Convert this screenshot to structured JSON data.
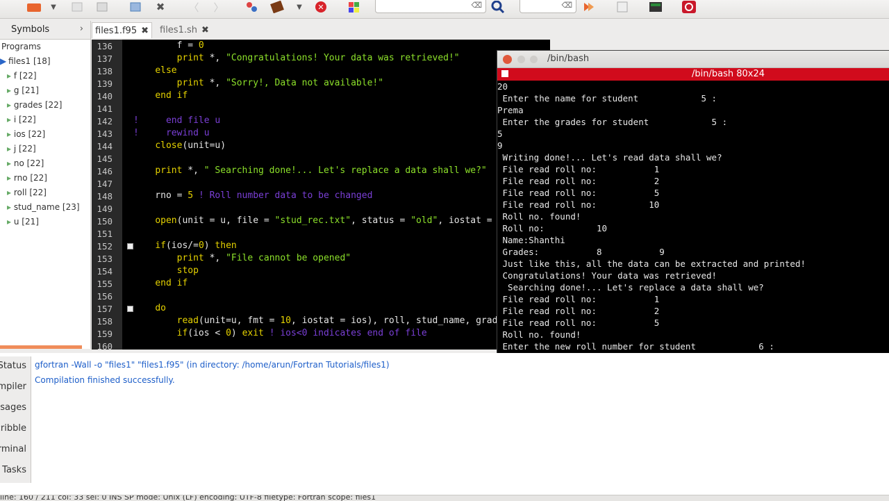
{
  "toolbar": {
    "icons": [
      "new-file-icon",
      "dropdown-arrow-icon",
      "open-icon",
      "save-icon",
      "revert-icon",
      "close-icon",
      "back-icon",
      "forward-icon",
      "compile-icon",
      "build-icon",
      "dropdown-arrow-icon",
      "stop-icon",
      "color-chooser-icon",
      "search-icon",
      "jump-icon",
      "preferences-icon",
      "terminal-icon",
      "quit-icon"
    ],
    "search_value": "",
    "goto_value": ""
  },
  "sidebar": {
    "tab_label": "Symbols",
    "tree": [
      {
        "label": "Programs"
      },
      {
        "label": "files1 [18]"
      },
      {
        "label": "f [22]"
      },
      {
        "label": "g [21]"
      },
      {
        "label": "grades [22]"
      },
      {
        "label": "i [22]"
      },
      {
        "label": "ios [22]"
      },
      {
        "label": "j [22]"
      },
      {
        "label": "no [22]"
      },
      {
        "label": "rno [22]"
      },
      {
        "label": "roll [22]"
      },
      {
        "label": "stud_name [23]"
      },
      {
        "label": "u [21]"
      }
    ]
  },
  "editor": {
    "tabs": [
      {
        "label": "files1.f95",
        "close": "✖"
      },
      {
        "label": "files1.sh",
        "close": "✖"
      }
    ],
    "line_numbers": [
      "136",
      "137",
      "138",
      "139",
      "140",
      "141",
      "142",
      "143",
      "144",
      "145",
      "146",
      "147",
      "148",
      "149",
      "150",
      "151",
      "152",
      "153",
      "154",
      "155",
      "156",
      "157",
      "158",
      "159",
      "160"
    ]
  },
  "terminal": {
    "window_title": "/bin/bash",
    "tab_title": "/bin/bash 80x24",
    "lines": [
      "20",
      " Enter the name for student            5 :",
      "Prema",
      " Enter the grades for student            5 :",
      "5",
      "9",
      " Writing done!... Let's read data shall we?",
      " File read roll no:           1",
      " File read roll no:           2",
      " File read roll no:           5",
      " File read roll no:          10",
      " Roll no. found!",
      " Roll no:          10",
      " Name:Shanthi",
      " Grades:           8           9",
      " Just like this, all the data can be extracted and printed!",
      " Congratulations! Your data was retrieved!",
      "  Searching done!... Let's replace a data shall we?",
      " File read roll no:           1",
      " File read roll no:           2",
      " File read roll no:           5",
      " Roll no. found!",
      " Enter the new roll number for student            6 :"
    ]
  },
  "messages": {
    "tabs": [
      "Status",
      "Compiler",
      "Messages",
      "Scribble",
      "Terminal",
      "Tasks"
    ],
    "lines": [
      "gfortran -Wall -o \"files1\" \"files1.f95\" (in directory: /home/arun/Fortran Tutorials/files1)",
      "Compilation finished successfully."
    ]
  },
  "statusbar": {
    "text": "line: 160 / 211    col: 33    sel: 0    INS    SP    mode: Unix (LF)    encoding: UTF-8    filetype: Fortran    scope: files1"
  }
}
